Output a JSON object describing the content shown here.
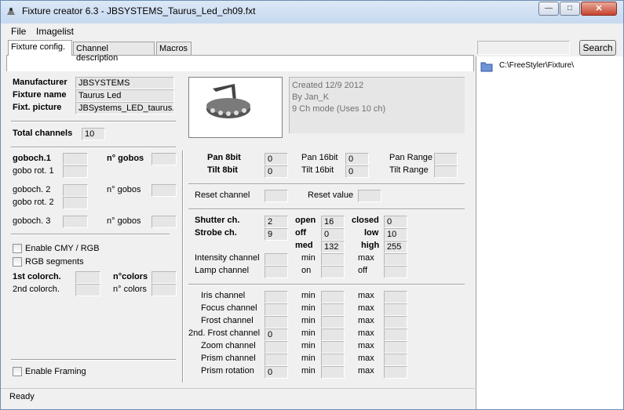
{
  "window": {
    "title": "Fixture creator 6.3 - JBSYSTEMS_Taurus_Led_ch09.fxt"
  },
  "menu": {
    "file": "File",
    "imagelist": "Imagelist"
  },
  "tabs": {
    "fixture_config": "Fixture config.",
    "channel_description": "Channel description",
    "macros": "Macros"
  },
  "search": {
    "button": "Search",
    "value": ""
  },
  "tree": {
    "path": "C:\\FreeStyler\\Fixture\\"
  },
  "fixture": {
    "manufacturer_label": "Manufacturer",
    "manufacturer": "JBSYSTEMS",
    "name_label": "Fixture name",
    "name": "Taurus Led",
    "picture_label": "Fixt. picture",
    "picture": "JBSystems_LED_taurus.g",
    "info_line1": "Created 12/9 2012",
    "info_line2": "By Jan_K",
    "info_line3": "9 Ch mode (Uses 10 ch)",
    "total_channels_label": "Total channels",
    "total_channels": "10"
  },
  "gobo": {
    "goboch1": "goboch.1",
    "nGobos1": "n° gobos",
    "goborot1": "gobo rot. 1",
    "goboch2": "goboch. 2",
    "nGobos2": "n° gobos",
    "goborot2": "gobo rot. 2",
    "goboch3": "goboch. 3",
    "nGobos3": "n° gobos"
  },
  "color": {
    "enable_cmy": "Enable CMY / RGB",
    "rgb_segments": "RGB segments",
    "colorch1": "1st colorch.",
    "ncolors1": "n°colors",
    "colorch2": "2nd colorch.",
    "ncolors2": "n° colors"
  },
  "framing": {
    "enable": "Enable Framing"
  },
  "pantilt": {
    "pan8": "Pan 8bit",
    "pan8_val": "0",
    "pan16": "Pan 16bit",
    "pan16_val": "0",
    "panrange": "Pan Range",
    "tilt8": "Tilt 8bit",
    "tilt8_val": "0",
    "tilt16": "Tilt 16bit",
    "tilt16_val": "0",
    "tiltrange": "Tilt Range"
  },
  "reset": {
    "channel": "Reset channel",
    "value": "Reset value"
  },
  "shutter": {
    "shutter_ch": "Shutter ch.",
    "shutter_val": "2",
    "open": "open",
    "open_val": "16",
    "closed": "closed",
    "closed_val": "0",
    "strobe_ch": "Strobe ch.",
    "strobe_val": "9",
    "off": "off",
    "off_val": "0",
    "low": "low",
    "low_val": "10",
    "med": "med",
    "med_val": "132",
    "high": "high",
    "high_val": "255",
    "intensity": "Intensity channel",
    "min": "min",
    "max": "max",
    "lamp": "Lamp channel",
    "on": "on",
    "off2": "off"
  },
  "effects": {
    "iris": "Iris channel",
    "focus": "Focus channel",
    "frost": "Frost channel",
    "frost2": "2nd. Frost channel",
    "frost2_val": "0",
    "zoom": "Zoom channel",
    "prism": "Prism channel",
    "prism_rot": "Prism rotation",
    "prism_rot_val": "0",
    "min": "min",
    "max": "max"
  },
  "status": {
    "text": "Ready"
  }
}
